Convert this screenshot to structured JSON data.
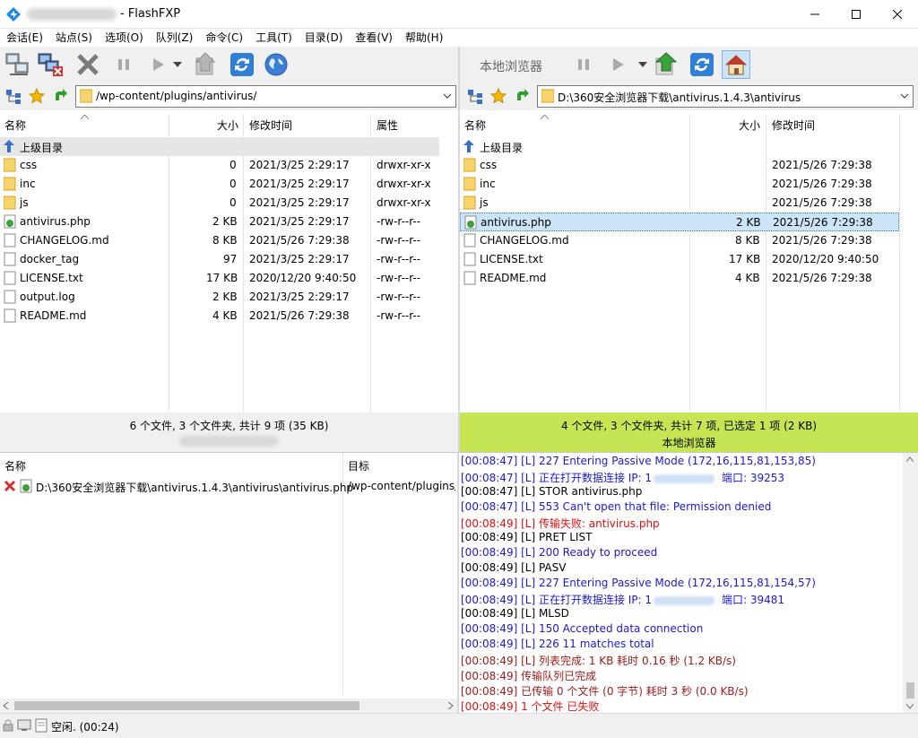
{
  "window": {
    "title": "- FlashFXP",
    "minimize": "─",
    "maximize": "☐",
    "close": "✕"
  },
  "menu": [
    "会话(E)",
    "站点(S)",
    "选项(O)",
    "队列(Z)",
    "命令(C)",
    "工具(T)",
    "目录(D)",
    "查看(V)",
    "帮助(H)"
  ],
  "right_toolbar_label": "本地浏览器",
  "remote": {
    "path": "/wp-content/plugins/antivirus/",
    "headers": {
      "name": "名称",
      "size": "大小",
      "modified": "修改时间",
      "attr": "属性"
    },
    "up_dir": "上级目录",
    "files": [
      {
        "name": "css",
        "size": "0",
        "modified": "2021/3/25 2:29:17",
        "attr": "drwxr-xr-x",
        "type": "folder"
      },
      {
        "name": "inc",
        "size": "0",
        "modified": "2021/3/25 2:29:17",
        "attr": "drwxr-xr-x",
        "type": "folder"
      },
      {
        "name": "js",
        "size": "0",
        "modified": "2021/3/25 2:29:17",
        "attr": "drwxr-xr-x",
        "type": "folder"
      },
      {
        "name": "antivirus.php",
        "size": "2 KB",
        "modified": "2021/3/25 2:29:17",
        "attr": "-rw-r--r--",
        "type": "php"
      },
      {
        "name": "CHANGELOG.md",
        "size": "8 KB",
        "modified": "2021/5/26 7:29:38",
        "attr": "-rw-r--r--",
        "type": "file"
      },
      {
        "name": "docker_tag",
        "size": "97",
        "modified": "2021/3/25 2:29:17",
        "attr": "-rw-r--r--",
        "type": "file"
      },
      {
        "name": "LICENSE.txt",
        "size": "17 KB",
        "modified": "2020/12/20 9:40:50",
        "attr": "-rw-r--r--",
        "type": "file"
      },
      {
        "name": "output.log",
        "size": "2 KB",
        "modified": "2021/3/25 2:29:17",
        "attr": "-rw-r--r--",
        "type": "file"
      },
      {
        "name": "README.md",
        "size": "4 KB",
        "modified": "2021/5/26 7:29:38",
        "attr": "-rw-r--r--",
        "type": "file"
      }
    ],
    "status": "6 个文件, 3 个文件夹, 共计 9 项 (35 KB)"
  },
  "local": {
    "path": "D:\\360安全浏览器下载\\antivirus.1.4.3\\antivirus",
    "headers": {
      "name": "名称",
      "size": "大小",
      "modified": "修改时间"
    },
    "up_dir": "上级目录",
    "files": [
      {
        "name": "css",
        "size": "",
        "modified": "2021/5/26 7:29:38",
        "type": "folder"
      },
      {
        "name": "inc",
        "size": "",
        "modified": "2021/5/26 7:29:38",
        "type": "folder"
      },
      {
        "name": "js",
        "size": "",
        "modified": "2021/5/26 7:29:38",
        "type": "folder"
      },
      {
        "name": "antivirus.php",
        "size": "2 KB",
        "modified": "2021/5/26 7:29:38",
        "type": "php",
        "selected": true
      },
      {
        "name": "CHANGELOG.md",
        "size": "8 KB",
        "modified": "2021/5/26 7:29:38",
        "type": "file"
      },
      {
        "name": "LICENSE.txt",
        "size": "17 KB",
        "modified": "2020/12/20 9:40:50",
        "type": "file"
      },
      {
        "name": "README.md",
        "size": "4 KB",
        "modified": "2021/5/26 7:29:38",
        "type": "file"
      }
    ],
    "status": "4 个文件, 3 个文件夹, 共计 7 项, 已选定 1 项 (2 KB)",
    "status2": "本地浏览器"
  },
  "queue": {
    "headers": {
      "name": "名称",
      "target": "目标"
    },
    "items": [
      {
        "name": "D:\\360安全浏览器下载\\antivirus.1.4.3\\antivirus\\antivirus.php",
        "target": "/wp-content/plugins/"
      }
    ]
  },
  "log": [
    {
      "t": "[00:08:47]",
      "msg": "[L] 227 Entering Passive Mode (172,16,115,81,153,85)",
      "c": "blue"
    },
    {
      "t": "[00:08:47]",
      "msg": "[L] 正在打开数据连接 IP: 1",
      "tail": "端口: 39253",
      "c": "blue",
      "blur": true
    },
    {
      "t": "[00:08:47]",
      "msg": "[L] STOR antivirus.php",
      "c": "black"
    },
    {
      "t": "[00:08:47]",
      "msg": "[L] 553 Can't open that file: Permission denied",
      "c": "blue"
    },
    {
      "t": "[00:08:49]",
      "msg": "[L] 传输失败: antivirus.php",
      "c": "red"
    },
    {
      "t": "[00:08:49]",
      "msg": "[L] PRET LIST",
      "c": "black"
    },
    {
      "t": "[00:08:49]",
      "msg": "[L] 200 Ready to proceed",
      "c": "blue"
    },
    {
      "t": "[00:08:49]",
      "msg": "[L] PASV",
      "c": "black"
    },
    {
      "t": "[00:08:49]",
      "msg": "[L] 227 Entering Passive Mode (172,16,115,81,154,57)",
      "c": "blue"
    },
    {
      "t": "[00:08:49]",
      "msg": "[L] 正在打开数据连接 IP: 1",
      "tail": "端口: 39481",
      "c": "blue",
      "blur": true
    },
    {
      "t": "[00:08:49]",
      "msg": "[L] MLSD",
      "c": "black"
    },
    {
      "t": "[00:08:49]",
      "msg": "[L] 150 Accepted data connection",
      "c": "blue"
    },
    {
      "t": "[00:08:49]",
      "msg": "[L] 226 11 matches total",
      "c": "blue"
    },
    {
      "t": "[00:08:49]",
      "msg": "[L] 列表完成: 1 KB 耗时 0.16 秒 (1.2 KB/s)",
      "c": "darkred"
    },
    {
      "t": "[00:08:49]",
      "msg": "传输队列已完成",
      "c": "darkred"
    },
    {
      "t": "[00:08:49]",
      "msg": "已传输 0 个文件 (0 字节) 耗时 3 秒 (0.0 KB/s)",
      "c": "darkred"
    },
    {
      "t": "[00:08:49]",
      "msg": "1 个文件 已失败",
      "c": "red"
    }
  ],
  "bottom_status": "空闲. (00:24)",
  "colors": {
    "blue": "#1a1ad0",
    "red": "#e01010",
    "darkred": "#9a1a1a",
    "black": "#000000",
    "green_status": "#c5e652"
  }
}
